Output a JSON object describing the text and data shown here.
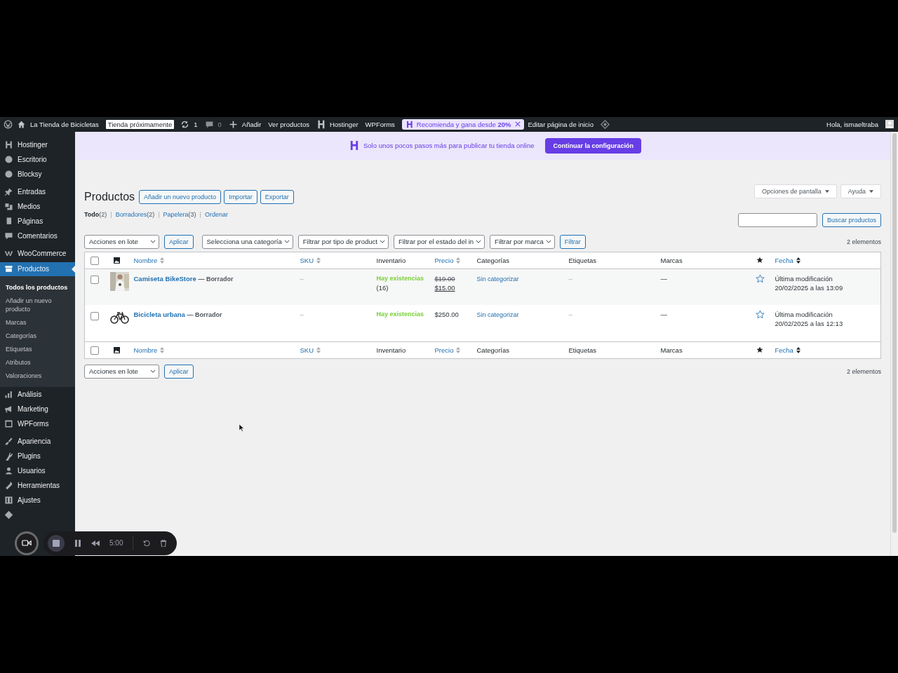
{
  "admin_bar": {
    "site_name": "La Tienda de Bicicletas",
    "badge": "Tienda próximamente",
    "updates": "1",
    "comments": "0",
    "add": "Añadir",
    "view": "Ver productos",
    "hostinger": "Hostinger",
    "wpforms": "WPForms",
    "promo": "Recomienda y gana desde **20%**",
    "edit_home": "Editar página de inicio",
    "greeting": "Hola, ismaeltraba"
  },
  "sidebar": {
    "groups": [
      [
        {
          "label": "Hostinger",
          "selected": false
        },
        {
          "label": "Escritorio",
          "selected": false
        },
        {
          "label": "Blocksy",
          "selected": false
        }
      ],
      [
        {
          "label": "Entradas",
          "selected": false
        },
        {
          "label": "Medios",
          "selected": false
        },
        {
          "label": "Páginas",
          "selected": false
        },
        {
          "label": "Comentarios",
          "selected": false
        }
      ],
      [
        {
          "label": "WooCommerce",
          "selected": false
        },
        {
          "label": "Productos",
          "selected": true,
          "children": [
            {
              "label": "Todos los productos",
              "selected": true
            },
            {
              "label": "Añadir un nuevo producto",
              "selected": false
            },
            {
              "label": "Marcas",
              "selected": false
            },
            {
              "label": "Categorías",
              "selected": false
            },
            {
              "label": "Etiquetas",
              "selected": false
            },
            {
              "label": "Atributos",
              "selected": false
            },
            {
              "label": "Valoraciones",
              "selected": false
            }
          ]
        },
        {
          "label": "Análisis",
          "selected": false
        },
        {
          "label": "Marketing",
          "selected": false
        },
        {
          "label": "WPForms",
          "selected": false
        }
      ],
      [
        {
          "label": "Apariencia",
          "selected": false
        },
        {
          "label": "Plugins",
          "selected": false
        },
        {
          "label": "Usuarios",
          "selected": false
        },
        {
          "label": "Herramientas",
          "selected": false
        },
        {
          "label": "Ajustes",
          "selected": false
        },
        {
          "selected": false
        }
      ]
    ]
  },
  "banner": {
    "text": "Solo unos pocos pasos más para publicar tu tienda online",
    "button": "Continuar la configuración"
  },
  "screen_options": [
    "Opciones de pantalla",
    "Ayuda"
  ],
  "page": {
    "title": "Productos",
    "actions": [
      "Añadir un nuevo producto",
      "Importar",
      "Exportar"
    ]
  },
  "views": [
    {
      "label": "Todo",
      "count": "(2)",
      "selected": true
    },
    {
      "sep": "|",
      "label": "Borradores",
      "count": "(2)",
      "selected": false
    },
    {
      "sep": "|",
      "label": "Papelera",
      "count": "(3)",
      "selected": false
    },
    {
      "sep": "|",
      "label": "Ordenar",
      "selected": false
    }
  ],
  "search": {
    "button": "Buscar productos"
  },
  "filters": {
    "bulk": "Acciones en lote",
    "apply": "Aplicar",
    "selects": [
      "Selecciona una categoría",
      "Filtrar por tipo de product",
      "Filtrar por el estado del in",
      "Filtrar por marca"
    ],
    "filter": "Filtrar",
    "count": "2 elementos"
  },
  "table": {
    "header": {
      "select_all_checked": false,
      "columns": [
        {
          "label": "Nombre",
          "sortable": true
        },
        {
          "label": "SKU",
          "sortable": true
        },
        {
          "label": "Inventario",
          "sortable": false
        },
        {
          "label": "Precio",
          "sortable": true
        },
        {
          "label": "Categorías",
          "sortable": false
        },
        {
          "label": "Etiquetas",
          "sortable": false
        },
        {
          "label": "Marcas",
          "sortable": false
        },
        {
          "label": "Fecha",
          "sortable": true
        }
      ]
    },
    "footer": {
      "select_all_checked": false,
      "columns": [
        {
          "label": "Nombre",
          "sortable": true
        },
        {
          "label": "SKU",
          "sortable": true
        },
        {
          "label": "Inventario",
          "sortable": false
        },
        {
          "label": "Precio",
          "sortable": true
        },
        {
          "label": "Categorías",
          "sortable": false
        },
        {
          "label": "Etiquetas",
          "sortable": false
        },
        {
          "label": "Marcas",
          "sortable": false
        },
        {
          "label": "Fecha",
          "sortable": true
        }
      ]
    },
    "rows": [
      {
        "name": "Camiseta BikeStore",
        "status": "— Borrador",
        "sku": "–",
        "stock": "Hay existencias",
        "stock_count": "(16)",
        "price": {
          "regular": "$19.00",
          "sale": "$15.00"
        },
        "category": "Sin categorizar",
        "tags": "–",
        "brands": "—",
        "featured": false,
        "date_label": "Última modificación",
        "date": "20/02/2025 a las 13:09",
        "checked": false
      },
      {
        "name": "Bicicleta urbana",
        "status": "— Borrador",
        "sku": "–",
        "stock": "Hay existencias",
        "price": {
          "regular": "$250.00"
        },
        "category": "Sin categorizar",
        "tags": "–",
        "brands": "—",
        "featured": false,
        "date_label": "Última modificación",
        "date": "20/02/2025 a las 12:13",
        "checked": false
      }
    ]
  },
  "bottom": {
    "bulk": "Acciones en lote",
    "apply": "Aplicar",
    "count": "2 elementos"
  },
  "recorder": {
    "time": "5:00"
  }
}
